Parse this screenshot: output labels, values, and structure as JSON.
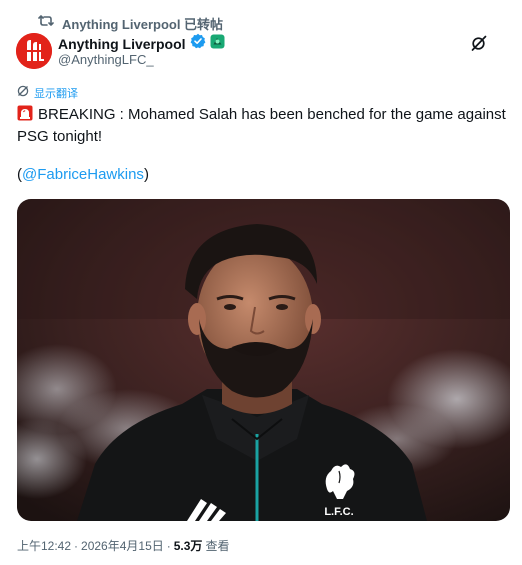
{
  "repost": {
    "text": "Anything Liverpool 已转帖"
  },
  "author": {
    "name": "Anything Liverpool",
    "handle": "@AnythingLFC_",
    "verified_color": "#1d9bf0"
  },
  "translate": {
    "label": "显示翻译"
  },
  "tweet": {
    "body": "BREAKING : Mohamed Salah has been benched for the game against PSG tonight!",
    "credit_open": "(",
    "mention": "@FabriceHawkins",
    "credit_close": ")"
  },
  "meta": {
    "time": "上午12:42",
    "sep1": " · ",
    "date": "2026年4月15日",
    "sep2": " · ",
    "views": "5.3万",
    "views_label": "查看"
  },
  "photo": {
    "crest_text": "L.F.C."
  },
  "colors": {
    "brand_red": "#e2231a",
    "link": "#1d9bf0",
    "muted": "#536471"
  }
}
